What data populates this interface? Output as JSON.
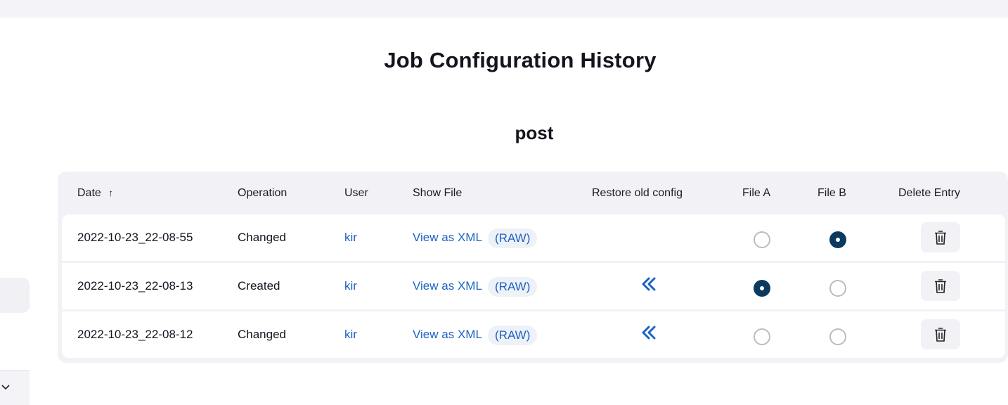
{
  "page": {
    "title": "Job Configuration History",
    "job_name": "post"
  },
  "table": {
    "headers": {
      "date": "Date",
      "sort_indicator": "↑",
      "operation": "Operation",
      "user": "User",
      "show_file": "Show File",
      "restore": "Restore old config",
      "file_a": "File A",
      "file_b": "File B",
      "delete": "Delete Entry"
    },
    "rows": [
      {
        "date": "2022-10-23_22-08-55",
        "operation": "Changed",
        "user": "kir",
        "view_xml": "View as XML",
        "raw": "(RAW)",
        "has_restore": false,
        "file_a_selected": false,
        "file_b_selected": true
      },
      {
        "date": "2022-10-23_22-08-13",
        "operation": "Created",
        "user": "kir",
        "view_xml": "View as XML",
        "raw": "(RAW)",
        "has_restore": true,
        "file_a_selected": true,
        "file_b_selected": false
      },
      {
        "date": "2022-10-23_22-08-12",
        "operation": "Changed",
        "user": "kir",
        "view_xml": "View as XML",
        "raw": "(RAW)",
        "has_restore": true,
        "file_a_selected": false,
        "file_b_selected": false
      }
    ]
  },
  "icons": {
    "restore": "double-chevron-left-icon",
    "delete": "trash-icon",
    "dropdown": "chevron-down-icon"
  },
  "colors": {
    "link": "#1a63c4",
    "radio_checked": "#0b3a60",
    "table_bg": "#f2f2f6"
  }
}
